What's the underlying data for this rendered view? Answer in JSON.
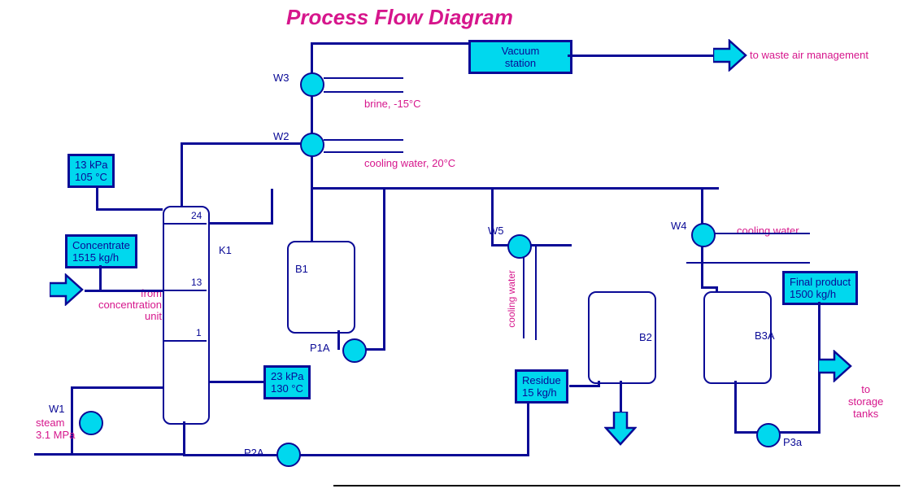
{
  "title": "Process Flow Diagram",
  "vacuum_station": "Vacuum\nstation",
  "to_waste_air": "to waste air management",
  "brine_label": "brine, -15°C",
  "cooling_water_20": "cooling water, 20°C",
  "conditions_top": "13 kPa\n105 °C",
  "conditions_bottom": "23 kPa\n130 °C",
  "concentrate": "Concentrate\n1515 kg/h",
  "from_concentration": "from\nconcentration unit",
  "steam": "steam\n3.1 MPa",
  "residue": "Residue\n15 kg/h",
  "final_product": "Final product\n1500 kg/h",
  "to_storage": "to\nstorage\ntanks",
  "cooling_water": "cooling water",
  "cooling_water_v": "cooling water",
  "labels": {
    "W1": "W1",
    "W2": "W2",
    "W3": "W3",
    "W4": "W4",
    "W5": "W5",
    "K1": "K1",
    "B1": "B1",
    "B2": "B2",
    "B3A": "B3A",
    "P1A": "P1A",
    "P2A": "P2A",
    "P3a": "P3a",
    "tray24": "24",
    "tray13": "13",
    "tray1": "1"
  }
}
